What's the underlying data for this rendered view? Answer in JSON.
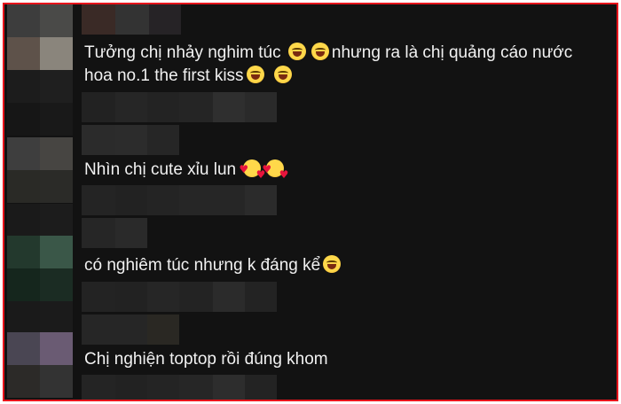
{
  "comments": [
    {
      "text_a": "Tưởng chị nhảy nghim túc",
      "text_b": "nhưng ra là chị quảng cáo nước",
      "text_c": "hoa no.1 the first kiss",
      "emojis": [
        "laugh-emoji",
        "laugh-emoji",
        "laugh-emoji",
        "laugh-emoji"
      ]
    },
    {
      "text": "Nhìn chị cute xỉu lun",
      "emojis": [
        "smiling-face-with-hearts-emoji",
        "smiling-face-with-hearts-emoji"
      ]
    },
    {
      "text": "có nghiêm túc nhưng k đáng kể",
      "emojis": [
        "laugh-emoji"
      ]
    },
    {
      "text": "Chị nghiện toptop rồi đúng khom",
      "emojis": []
    }
  ],
  "colors": {
    "frame_border": "#e8141b",
    "background": "#121212",
    "text": "#f1f1f1"
  }
}
